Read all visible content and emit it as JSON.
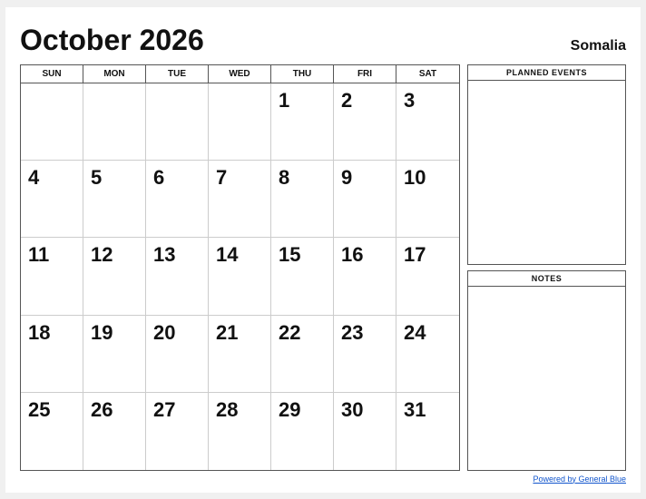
{
  "header": {
    "title": "October 2026",
    "country": "Somalia"
  },
  "calendar": {
    "days_of_week": [
      "SUN",
      "MON",
      "TUE",
      "WED",
      "THU",
      "FRI",
      "SAT"
    ],
    "weeks": [
      [
        "",
        "",
        "",
        "",
        "1",
        "2",
        "3"
      ],
      [
        "4",
        "5",
        "6",
        "7",
        "8",
        "9",
        "10"
      ],
      [
        "11",
        "12",
        "13",
        "14",
        "15",
        "16",
        "17"
      ],
      [
        "18",
        "19",
        "20",
        "21",
        "22",
        "23",
        "24"
      ],
      [
        "25",
        "26",
        "27",
        "28",
        "29",
        "30",
        "31"
      ]
    ]
  },
  "sidebar": {
    "planned_events_label": "PLANNED EVENTS",
    "notes_label": "NOTES"
  },
  "footer": {
    "link_text": "Powered by General Blue"
  }
}
